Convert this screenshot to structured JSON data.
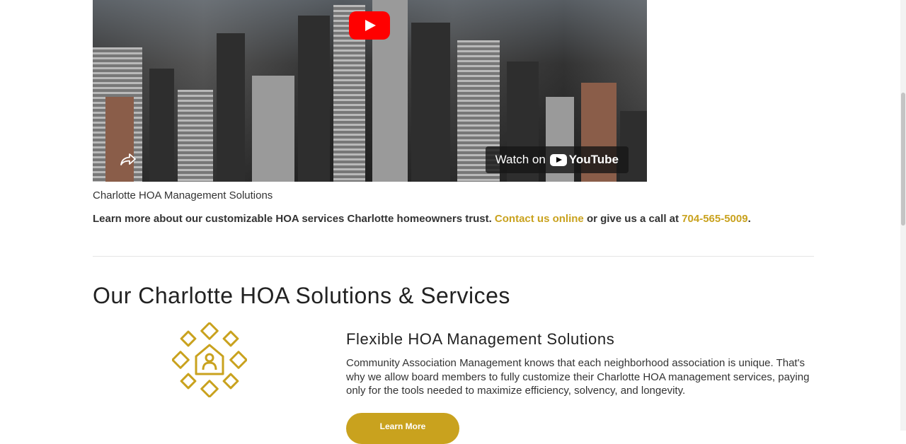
{
  "video": {
    "watch_on_label": "Watch on",
    "youtube_label": "YouTube"
  },
  "caption": "Charlotte HOA Management Solutions",
  "learn_line": {
    "text_before": "Learn more about our customizable HOA services Charlotte homeowners trust.",
    "contact_link": "Contact us online",
    "text_middle": "or give us a call at",
    "phone_link": "704-565-5009",
    "text_after": "."
  },
  "section_title": "Our Charlotte HOA Solutions & Services",
  "feature": {
    "title": "Flexible HOA Management Solutions",
    "description": "Community Association Management knows that each neighborhood association is unique. That's why we allow board members to fully customize their Charlotte HOA management services, paying only for the tools needed to maximize efficiency, solvency, and longevity.",
    "button_label": "Learn More"
  },
  "colors": {
    "accent": "#c9a21e",
    "youtube_red": "#ff0000"
  },
  "icons": {
    "video_play": "play-icon",
    "video_share": "share-icon",
    "feature": "community-network-icon"
  }
}
